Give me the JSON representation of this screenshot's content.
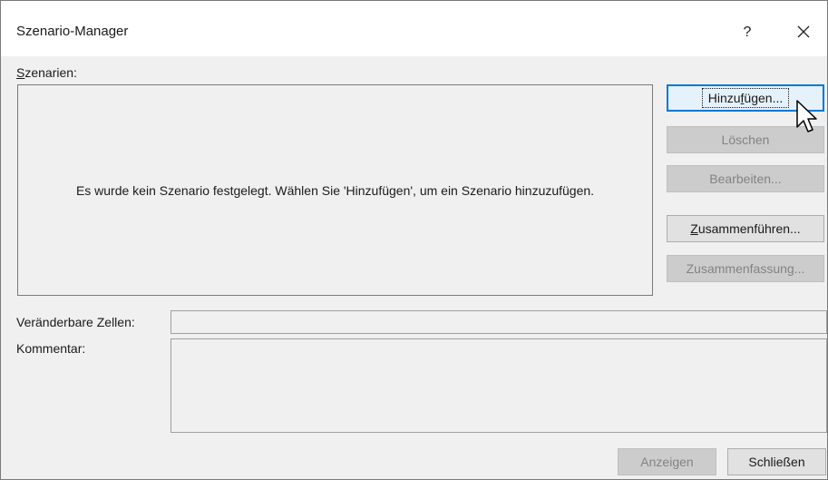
{
  "window": {
    "title": "Szenario-Manager",
    "help_label": "?",
    "close_icon": "close-icon"
  },
  "scenarios": {
    "label_mnemonic": "S",
    "label_rest": "zenarien:",
    "empty_message": "Es wurde kein Szenario festgelegt. Wählen Sie 'Hinzufügen', um ein Szenario hinzuzufügen."
  },
  "buttons": {
    "add_pre": "Hinzu",
    "add_mnemonic": "f",
    "add_post": "ügen...",
    "delete": "Löschen",
    "edit": "Bearbeiten...",
    "merge_mnemonic": "Z",
    "merge_rest": "usammenführen...",
    "summary": "Zusammenfassung...",
    "show": "Anzeigen",
    "close": "Schließen"
  },
  "fields": {
    "changing_cells_label": "Veränderbare Zellen:",
    "changing_cells_value": "",
    "comment_label": "Kommentar:",
    "comment_value": ""
  },
  "colors": {
    "accent": "#0078d7",
    "dialog_bg": "#f0f0f0",
    "disabled_text": "#838383"
  }
}
